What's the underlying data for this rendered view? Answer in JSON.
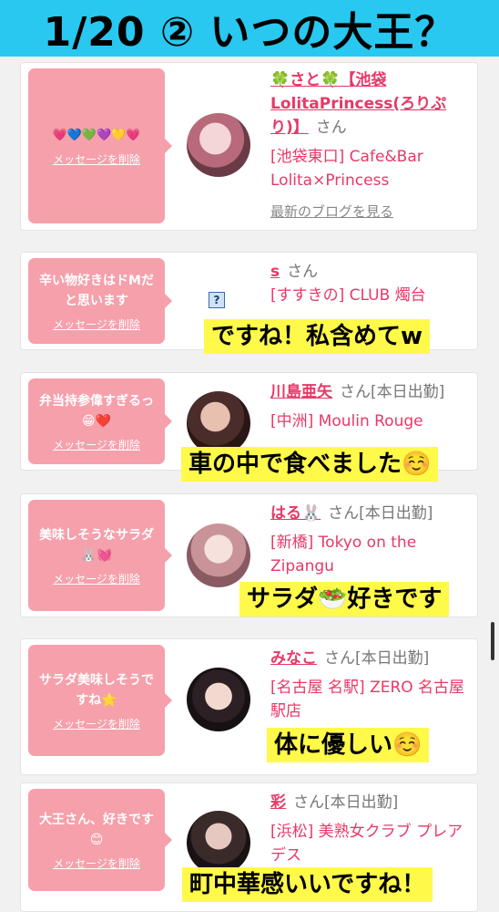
{
  "header": {
    "title": "1/20 ② いつの大王？"
  },
  "cards": [
    {
      "message": "💗💙💚💜💛💗",
      "delete_label": "メッセージを削除",
      "name": "🍀さと🍀【池袋LolitaPrincess(ろりぷり)】",
      "san": "さん",
      "shop": "[池袋東口] Cafe&Bar Lolita×Princess",
      "blog_link": "最新のブログを見る"
    },
    {
      "message": "辛い物好きはドMだと思います",
      "delete_label": "メッセージを削除",
      "name": "s",
      "san": "さん",
      "shop": "[すすきの] CLUB 燭台",
      "caption": "ですね！私含めてw"
    },
    {
      "message": "弁当持参偉すぎるっ😁❤️",
      "delete_label": "メッセージを削除",
      "name": "川島亜矢",
      "san": "さん[本日出勤]",
      "shop": "[中洲] Moulin Rouge",
      "caption": "車の中で食べました☺️"
    },
    {
      "message": "美味しそうなサラダ🐰💓",
      "delete_label": "メッセージを削除",
      "name": "はる🐰",
      "san": "さん[本日出勤]",
      "shop": "[新橋] Tokyo on the Zipangu",
      "caption": "サラダ🥗好きです"
    },
    {
      "message": "サラダ美味しそうですね🌟",
      "delete_label": "メッセージを削除",
      "name": "みなこ",
      "san": "さん[本日出勤]",
      "shop": "[名古屋 名駅] ZERO 名古屋駅店",
      "caption": "体に優しい☺️"
    },
    {
      "message": "大王さん、好きです😊",
      "delete_label": "メッセージを削除",
      "name": "彩",
      "san": "さん[本日出勤]",
      "shop": "[浜松] 美熟女クラブ プレアデス",
      "caption": "町中華感いいですね！"
    }
  ],
  "colors": {
    "header_bg": "#28c8f0",
    "bubble_bg": "#f5a0ab",
    "name_pink": "#e83867",
    "caption_bg": "#fff94a"
  },
  "icons": {
    "broken_image": "question-mark-icon"
  }
}
